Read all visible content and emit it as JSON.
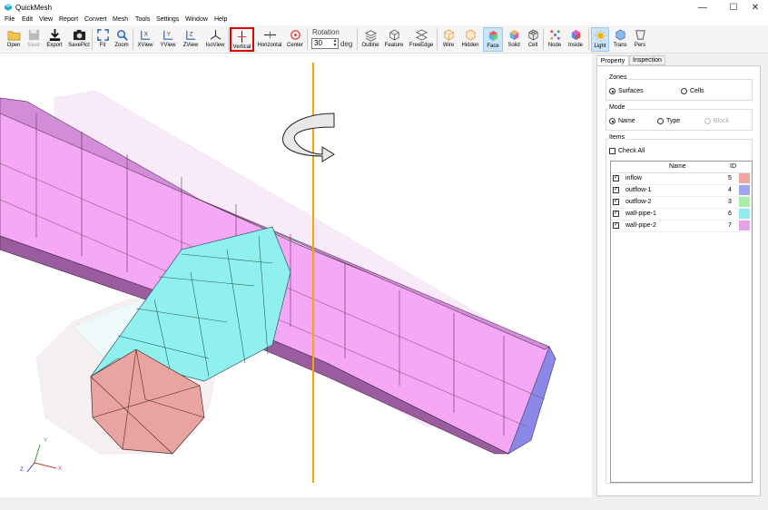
{
  "window": {
    "title": "QuickMesh",
    "minimize": "—",
    "maximize": "☐",
    "close": "✕"
  },
  "menu": [
    "File",
    "Edit",
    "View",
    "Report",
    "Convert",
    "Mesh",
    "Tools",
    "Settings",
    "Window",
    "Help"
  ],
  "toolbar": {
    "buttons": [
      {
        "label": "Open",
        "icon": "folder-open-icon"
      },
      {
        "label": "Save",
        "icon": "save-icon"
      },
      {
        "label": "Export",
        "icon": "export-icon"
      },
      {
        "label": "SavePict",
        "icon": "camera-icon"
      },
      {
        "label": "Fit",
        "icon": "fit-icon"
      },
      {
        "label": "Zoom",
        "icon": "zoom-icon"
      },
      {
        "label": "XView",
        "icon": "x-axis-view-icon"
      },
      {
        "label": "YView",
        "icon": "y-axis-view-icon"
      },
      {
        "label": "ZView",
        "icon": "z-axis-view-icon"
      },
      {
        "label": "IsoView",
        "icon": "iso-view-icon"
      },
      {
        "label": "Vertical",
        "icon": "vertical-axis-icon"
      },
      {
        "label": "Horizontal",
        "icon": "horizontal-axis-icon"
      },
      {
        "label": "Center",
        "icon": "center-icon"
      },
      {
        "label": "Outline",
        "icon": "outline-icon"
      },
      {
        "label": "Feature",
        "icon": "feature-icon"
      },
      {
        "label": "FreeEdge",
        "icon": "free-edge-icon"
      },
      {
        "label": "Wire",
        "icon": "wire-icon"
      },
      {
        "label": "Hidden",
        "icon": "hidden-icon"
      },
      {
        "label": "Face",
        "icon": "face-icon"
      },
      {
        "label": "Solid",
        "icon": "solid-icon"
      },
      {
        "label": "Cell",
        "icon": "cell-icon"
      },
      {
        "label": "Node",
        "icon": "node-icon"
      },
      {
        "label": "Inside",
        "icon": "inside-icon"
      },
      {
        "label": "Light",
        "icon": "light-icon"
      },
      {
        "label": "Trans",
        "icon": "transparency-icon"
      },
      {
        "label": "Pers",
        "icon": "perspective-icon"
      }
    ],
    "rotation_label": "Rotation",
    "rotation_value": "30",
    "rotation_unit": "deg"
  },
  "viewport": {
    "axis_labels": {
      "x": "X",
      "y": "Y",
      "z": "Z"
    },
    "colors": {
      "pink": "#f5a3f5",
      "cyan": "#8ef2ee",
      "salmon": "#e9a3a0",
      "blue": "#9aa2ec",
      "axis_line": "#f5a600"
    }
  },
  "panel": {
    "tabs": [
      "Property",
      "Inspection"
    ],
    "zones": {
      "label": "Zones",
      "options": [
        "Surfaces",
        "Cells"
      ],
      "selected": "Surfaces"
    },
    "mode": {
      "label": "Mode",
      "options": [
        "Name",
        "Type",
        "Block"
      ],
      "selected": "Name"
    },
    "items": {
      "label": "Items",
      "check_all": "Check All",
      "columns": [
        "Name",
        "ID"
      ],
      "rows": [
        {
          "name": "inflow",
          "id": "5",
          "color": "#f0a6a0"
        },
        {
          "name": "outflow-1",
          "id": "4",
          "color": "#a0a6f0"
        },
        {
          "name": "outflow-2",
          "id": "3",
          "color": "#a6f0a6"
        },
        {
          "name": "wall-pipe-1",
          "id": "6",
          "color": "#90ecea"
        },
        {
          "name": "wall-pipe-2",
          "id": "7",
          "color": "#e8a0ea"
        }
      ]
    }
  }
}
